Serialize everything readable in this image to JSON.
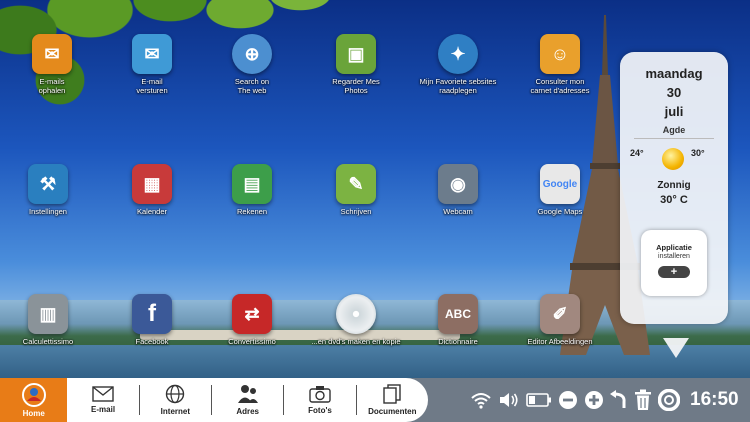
{
  "desktop": {
    "icons": [
      {
        "label": "E-mails\nophalen",
        "icon": "email-download-icon",
        "color": "#e48a1c"
      },
      {
        "label": "E-mail\nversturen",
        "icon": "email-send-icon",
        "color": "#3f9ad6"
      },
      {
        "label": "Search on\nThe web",
        "icon": "globe-www-icon",
        "color": "#4c8fd0"
      },
      {
        "label": "Regarder Mes\nPhotos",
        "icon": "photos-icon",
        "color": "#6aa43a"
      },
      {
        "label": "Mijn Favoriete sebsites\nraadplegen",
        "icon": "favorites-globe-icon",
        "color": "#2f7fc4"
      },
      {
        "label": "Consulter mon\ncarnet d'adresses",
        "icon": "address-book-icon",
        "color": "#e9a02c"
      },
      {
        "label": "Instellingen",
        "icon": "settings-tools-icon",
        "color": "#2a7fbf"
      },
      {
        "label": "Kalender",
        "icon": "calendar-icon",
        "color": "#c83a3a"
      },
      {
        "label": "Rekenen",
        "icon": "spreadsheet-icon",
        "color": "#3d9e4a"
      },
      {
        "label": "Schrijven",
        "icon": "document-write-icon",
        "color": "#7cb342"
      },
      {
        "label": "Webcam",
        "icon": "webcam-icon",
        "color": "#6c7c8c"
      },
      {
        "label": "Google Maps",
        "icon": "google-maps-icon",
        "color": "#e8e8e8"
      },
      {
        "label": "Calculettissimo",
        "icon": "calculator-icon",
        "color": "#8a9399"
      },
      {
        "label": "Facebook",
        "icon": "facebook-icon",
        "color": "#3b5998"
      },
      {
        "label": "Convertissimo",
        "icon": "converter-icon",
        "color": "#c62828"
      },
      {
        "label": "...en dvd's maken en kopie",
        "icon": "dvd-icon",
        "color": "#cfd8dc"
      },
      {
        "label": "Dictionnaire",
        "icon": "dictionary-icon",
        "color": "#8d6e63"
      },
      {
        "label": "Editor Afbeeldingen",
        "icon": "image-editor-icon",
        "color": "#a1887f"
      }
    ]
  },
  "weather": {
    "day": "maandag",
    "date": "30",
    "month": "juli",
    "city": "Agde",
    "temp_min": "24°",
    "temp_max": "30°",
    "condition": "Zonnig",
    "current_temp": "30° C",
    "icon": "sun-icon"
  },
  "app_install": {
    "line1": "Applicatie",
    "line2": "installeren",
    "plus": "+"
  },
  "taskbar": {
    "home": "Home",
    "items": [
      {
        "label": "E-mail",
        "icon": "envelope-icon"
      },
      {
        "label": "Internet",
        "icon": "globe-icon"
      },
      {
        "label": "Adres",
        "icon": "contacts-icon"
      },
      {
        "label": "Foto's",
        "icon": "camera-icon"
      },
      {
        "label": "Documenten",
        "icon": "documents-icon"
      }
    ],
    "clock": "16:50"
  }
}
